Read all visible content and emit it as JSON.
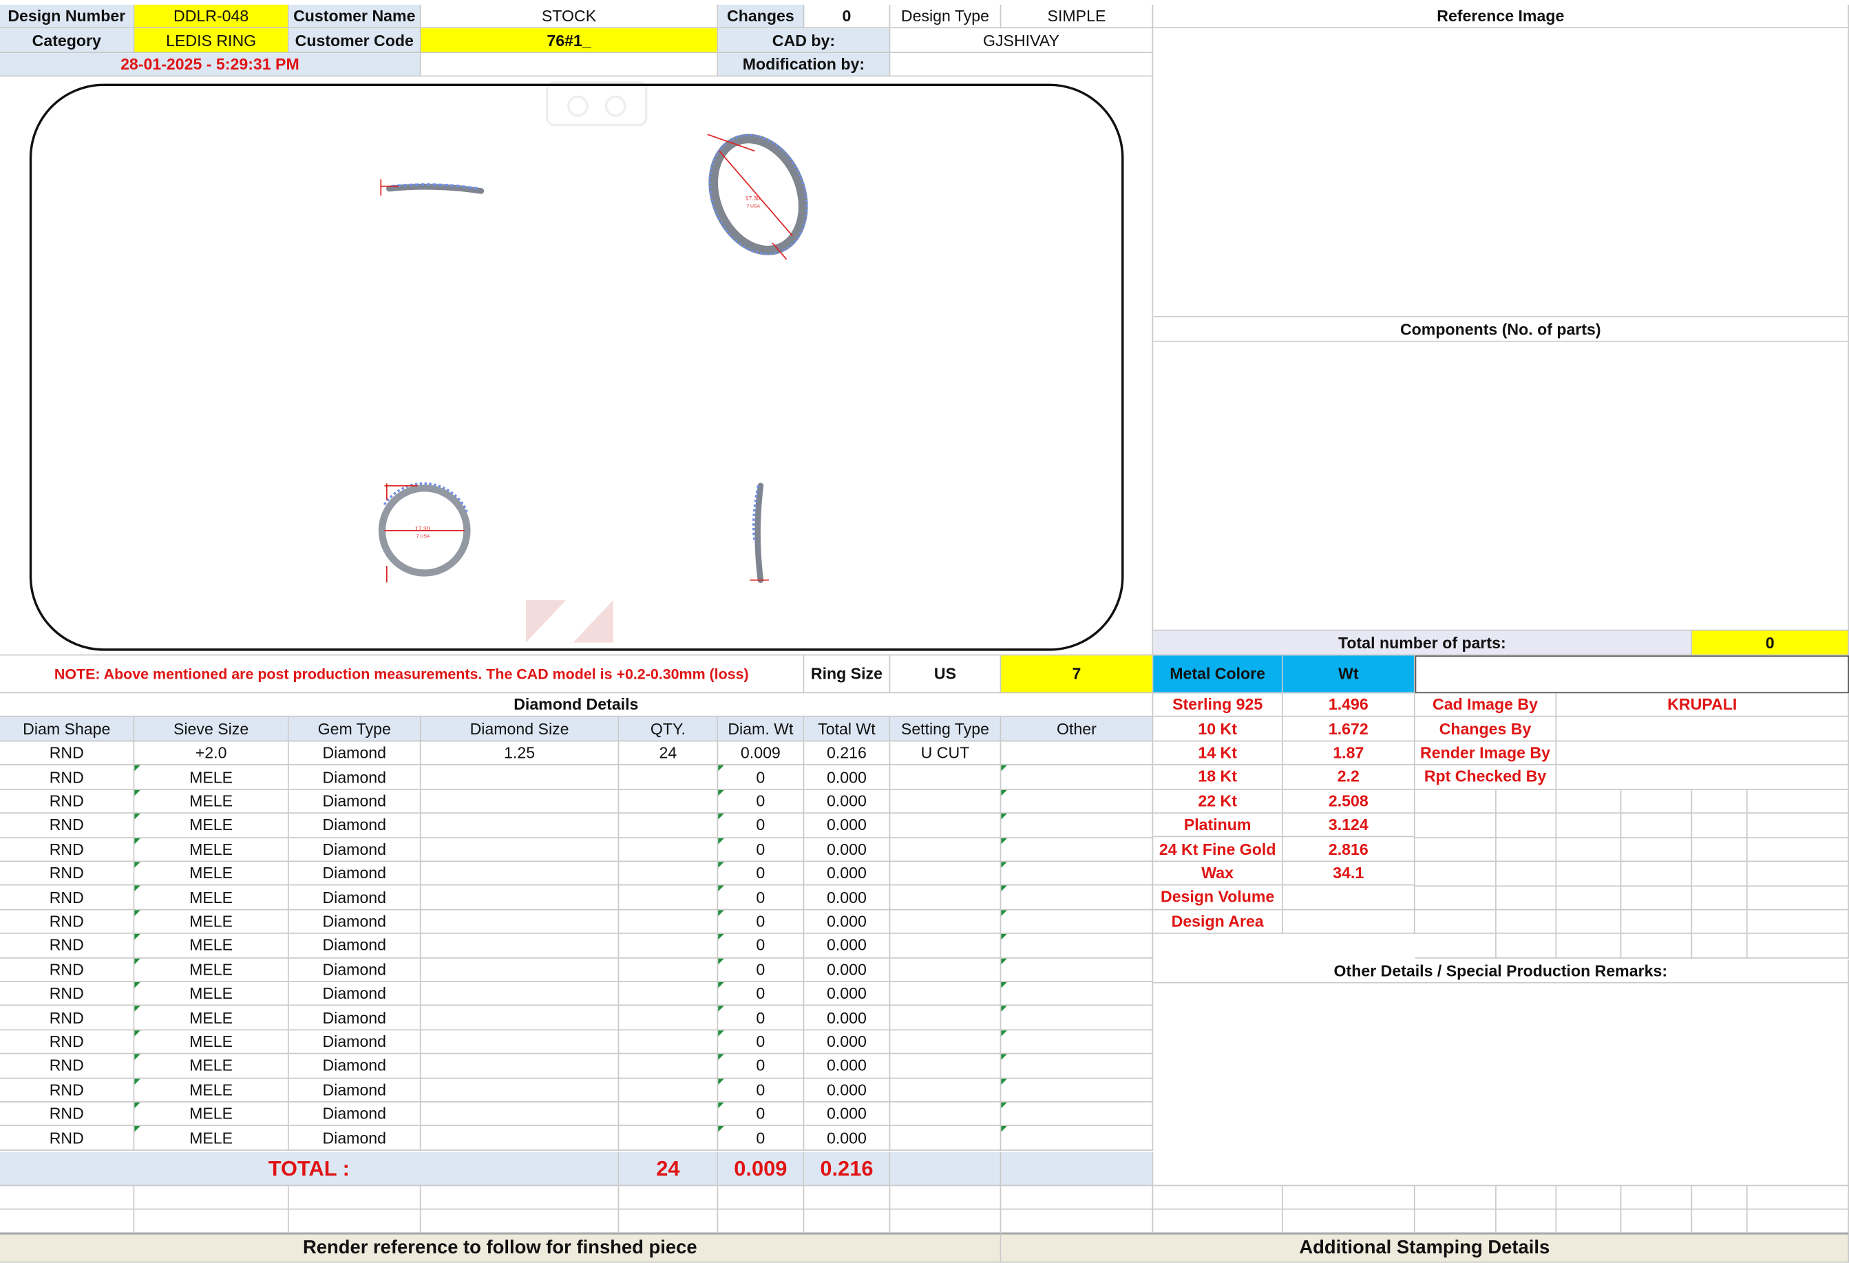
{
  "header": {
    "design_number_label": "Design Number",
    "design_number": "DDLR-048",
    "customer_name_label": "Customer Name",
    "customer_name": "STOCK",
    "changes_label": "Changes",
    "changes": "0",
    "design_type_label": "Design Type",
    "design_type": "SIMPLE",
    "category_label": "Category",
    "category": "LEDIS RING",
    "customer_code_label": "Customer Code",
    "customer_code": "76#1_",
    "cad_by_label": "CAD by:",
    "cad_by": "GJSHIVAY",
    "timestamp": "28-01-2025 - 5:29:31 PM",
    "modification_by_label": "Modification by:",
    "modification_by": ""
  },
  "right_panel": {
    "reference_image_label": "Reference Image",
    "components_label": "Components (No. of parts)",
    "total_parts_label": "Total number of parts:",
    "total_parts": "0"
  },
  "note": "NOTE: Above mentioned are post production measurements. The CAD model is +0.2-0.30mm (loss)",
  "ring": {
    "ring_size_label": "Ring Size",
    "ring_size_unit": "US",
    "ring_size": "7"
  },
  "metal": {
    "color_label": "Metal Colore",
    "wt_label": "Wt",
    "rows": [
      {
        "name": "Sterling 925",
        "wt": "1.496"
      },
      {
        "name": "10 Kt",
        "wt": "1.672"
      },
      {
        "name": "14 Kt",
        "wt": "1.87"
      },
      {
        "name": "18 Kt",
        "wt": "2.2"
      },
      {
        "name": "22 Kt",
        "wt": "2.508"
      },
      {
        "name": "Platinum",
        "wt": "3.124"
      },
      {
        "name": "24 Kt Fine Gold",
        "wt": "2.816"
      },
      {
        "name": "Wax",
        "wt": "34.1"
      },
      {
        "name": "Design Volume",
        "wt": ""
      },
      {
        "name": "Design Area",
        "wt": ""
      }
    ]
  },
  "credits": [
    {
      "label": "Cad Image By",
      "value": "KRUPALI"
    },
    {
      "label": "Changes By",
      "value": ""
    },
    {
      "label": "Render Image By",
      "value": ""
    },
    {
      "label": "Rpt Checked By",
      "value": ""
    }
  ],
  "diamond": {
    "title": "Diamond Details",
    "headers": [
      "Diam Shape",
      "Sieve Size",
      "Gem Type",
      "Diamond Size",
      "QTY.",
      "Diam. Wt",
      "Total Wt",
      "Setting Type",
      "Other"
    ],
    "rows": [
      [
        "RND",
        "+2.0",
        "Diamond",
        "1.25",
        "24",
        "0.009",
        "0.216",
        "U CUT",
        ""
      ],
      [
        "RND",
        "MELE",
        "Diamond",
        "",
        "",
        "0",
        "0.000",
        "",
        ""
      ],
      [
        "RND",
        "MELE",
        "Diamond",
        "",
        "",
        "0",
        "0.000",
        "",
        ""
      ],
      [
        "RND",
        "MELE",
        "Diamond",
        "",
        "",
        "0",
        "0.000",
        "",
        ""
      ],
      [
        "RND",
        "MELE",
        "Diamond",
        "",
        "",
        "0",
        "0.000",
        "",
        ""
      ],
      [
        "RND",
        "MELE",
        "Diamond",
        "",
        "",
        "0",
        "0.000",
        "",
        ""
      ],
      [
        "RND",
        "MELE",
        "Diamond",
        "",
        "",
        "0",
        "0.000",
        "",
        ""
      ],
      [
        "RND",
        "MELE",
        "Diamond",
        "",
        "",
        "0",
        "0.000",
        "",
        ""
      ],
      [
        "RND",
        "MELE",
        "Diamond",
        "",
        "",
        "0",
        "0.000",
        "",
        ""
      ],
      [
        "RND",
        "MELE",
        "Diamond",
        "",
        "",
        "0",
        "0.000",
        "",
        ""
      ],
      [
        "RND",
        "MELE",
        "Diamond",
        "",
        "",
        "0",
        "0.000",
        "",
        ""
      ],
      [
        "RND",
        "MELE",
        "Diamond",
        "",
        "",
        "0",
        "0.000",
        "",
        ""
      ],
      [
        "RND",
        "MELE",
        "Diamond",
        "",
        "",
        "0",
        "0.000",
        "",
        ""
      ],
      [
        "RND",
        "MELE",
        "Diamond",
        "",
        "",
        "0",
        "0.000",
        "",
        ""
      ],
      [
        "RND",
        "MELE",
        "Diamond",
        "",
        "",
        "0",
        "0.000",
        "",
        ""
      ],
      [
        "RND",
        "MELE",
        "Diamond",
        "",
        "",
        "0",
        "0.000",
        "",
        ""
      ],
      [
        "RND",
        "MELE",
        "Diamond",
        "",
        "",
        "0",
        "0.000",
        "",
        ""
      ]
    ],
    "total_label": "TOTAL :",
    "total_qty": "24",
    "total_diam_wt": "0.009",
    "total_wt": "0.216"
  },
  "remarks_label": "Other Details / Special Production Remarks:",
  "footer": {
    "render_reference": "Render reference to follow for finshed piece",
    "stamping": "Additional Stamping Details"
  },
  "cad_views": {
    "dimension_text": "17.30",
    "size_text": "7 USA"
  },
  "colors": {
    "label_bg": "#dde7f4",
    "highlight": "#ffff00",
    "accent_red": "#e01414",
    "metal_header": "#08b0f0",
    "footer_bg": "#eeeadc"
  }
}
